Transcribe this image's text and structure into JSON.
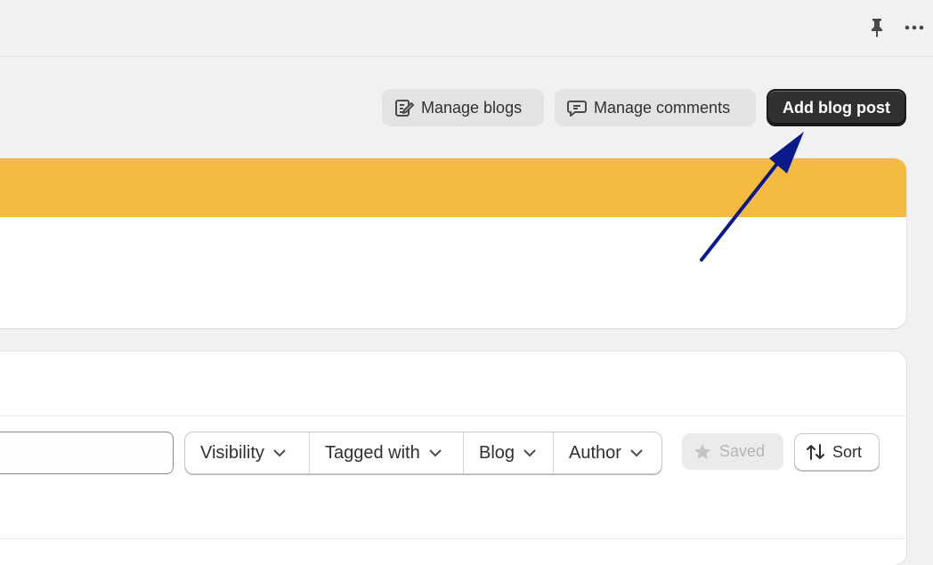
{
  "header": {
    "icons": [
      "pin-icon",
      "more-horizontal-icon"
    ]
  },
  "actions": {
    "manage_blogs": "Manage blogs",
    "manage_comments": "Manage comments",
    "add_blog_post": "Add blog post"
  },
  "filters": {
    "search_value": "",
    "items": [
      {
        "label": "Visibility"
      },
      {
        "label": "Tagged with"
      },
      {
        "label": "Blog"
      },
      {
        "label": "Author"
      }
    ],
    "saved_label": "Saved",
    "sort_label": "Sort"
  },
  "colors": {
    "banner": "#f4bb40",
    "primary_button": "#303030",
    "annotation_arrow": "#0a1a8c"
  }
}
